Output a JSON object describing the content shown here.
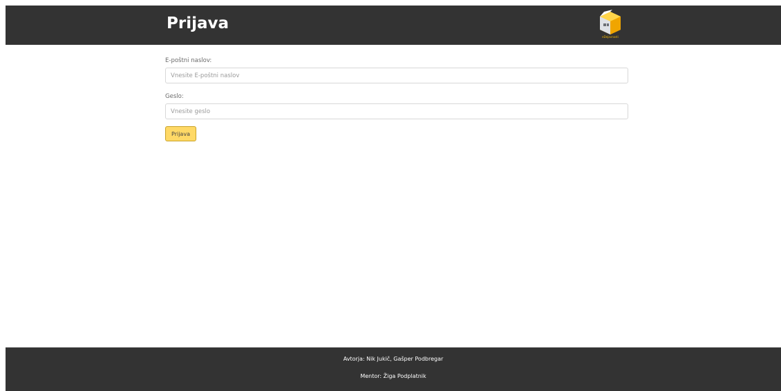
{
  "header": {
    "title": "Prijava",
    "logo_text": "eDejavnosti",
    "logo_icon": "house-cube-logo"
  },
  "form": {
    "email": {
      "label": "E-poštni naslov:",
      "placeholder": "Vnesite E-poštni naslov",
      "value": ""
    },
    "password": {
      "label": "Geslo:",
      "placeholder": "Vnesite geslo",
      "value": ""
    },
    "submit_label": "Prijava"
  },
  "footer": {
    "authors": "Avtorja: Nik Jukič, Gašper Podbregar",
    "mentor": "Mentor: Žiga Podplatnik"
  },
  "colors": {
    "header_bg": "#333333",
    "footer_bg": "#333333",
    "button_bg": "#ffd966",
    "logo_accent": "#f5b800"
  }
}
